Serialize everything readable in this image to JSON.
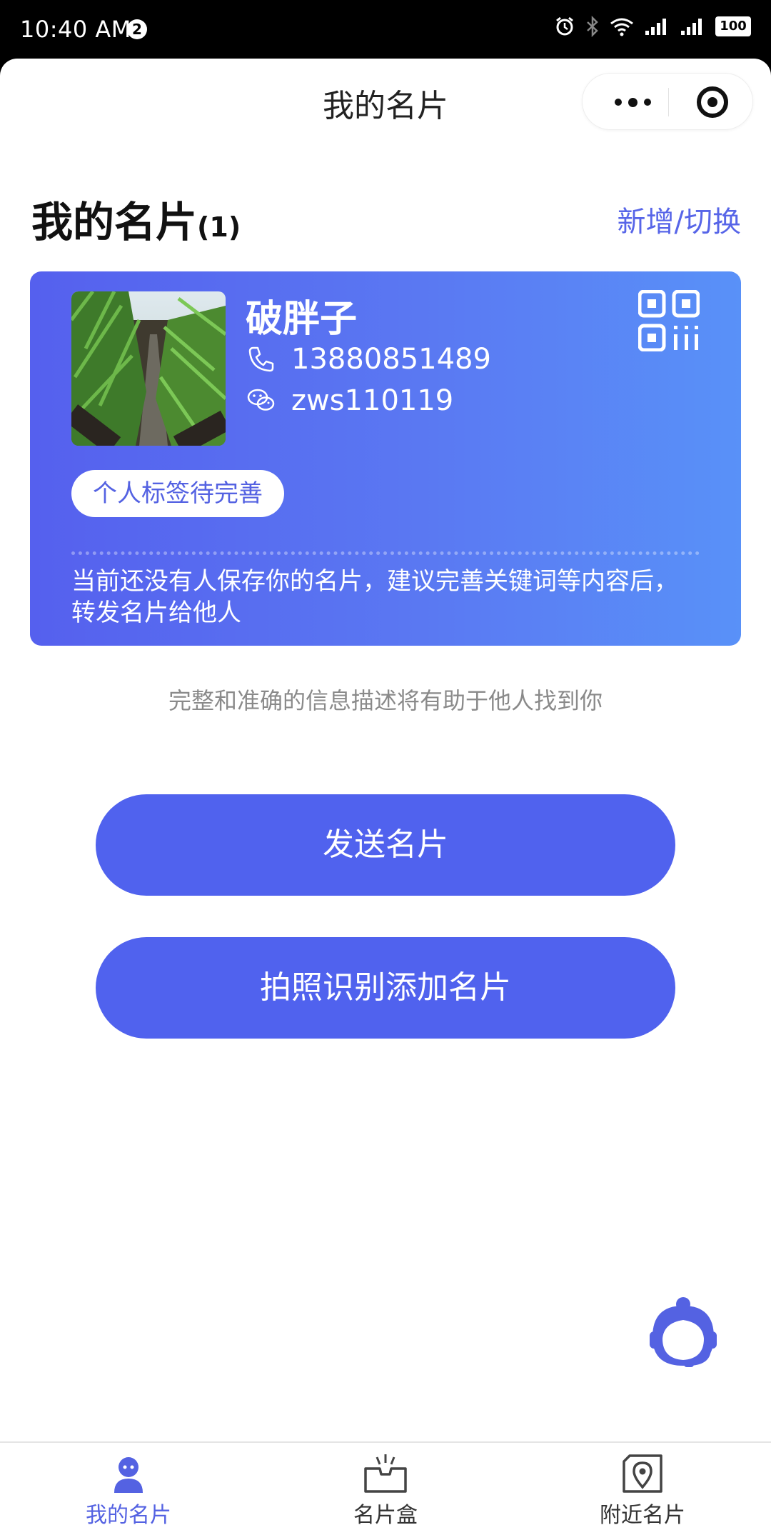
{
  "status_bar": {
    "time": "10:40 AM",
    "notification_count": "2",
    "battery": "100",
    "icons": [
      "alarm-icon",
      "bluetooth-icon",
      "wifi-icon",
      "signal-icon",
      "signal-icon",
      "battery-icon"
    ]
  },
  "nav": {
    "title": "我的名片",
    "more_icon": "more-dots-icon",
    "close_icon": "target-icon"
  },
  "header": {
    "title": "我的名片",
    "count": "(1)",
    "switch_label": "新增/切换"
  },
  "card": {
    "name": "破胖子",
    "phone": "13880851489",
    "wechat": "zws110119",
    "tag": "个人标签待完善",
    "tip": "当前还没有人保存你的名片，建议完善关键词等内容后，转发名片给他人",
    "colors": {
      "gradient_start": "#5560ee",
      "gradient_end": "#5991f8"
    }
  },
  "hint": "完整和准确的信息描述将有助于他人找到你",
  "buttons": {
    "send": "发送名片",
    "scan": "拍照识别添加名片",
    "color": "#5062ee"
  },
  "tabbar": {
    "items": [
      {
        "label": "我的名片",
        "icon": "profile-icon",
        "active": true
      },
      {
        "label": "名片盒",
        "icon": "card-box-icon",
        "active": false
      },
      {
        "label": "附近名片",
        "icon": "nearby-location-icon",
        "active": false
      }
    ],
    "active_color": "#5462e2"
  }
}
